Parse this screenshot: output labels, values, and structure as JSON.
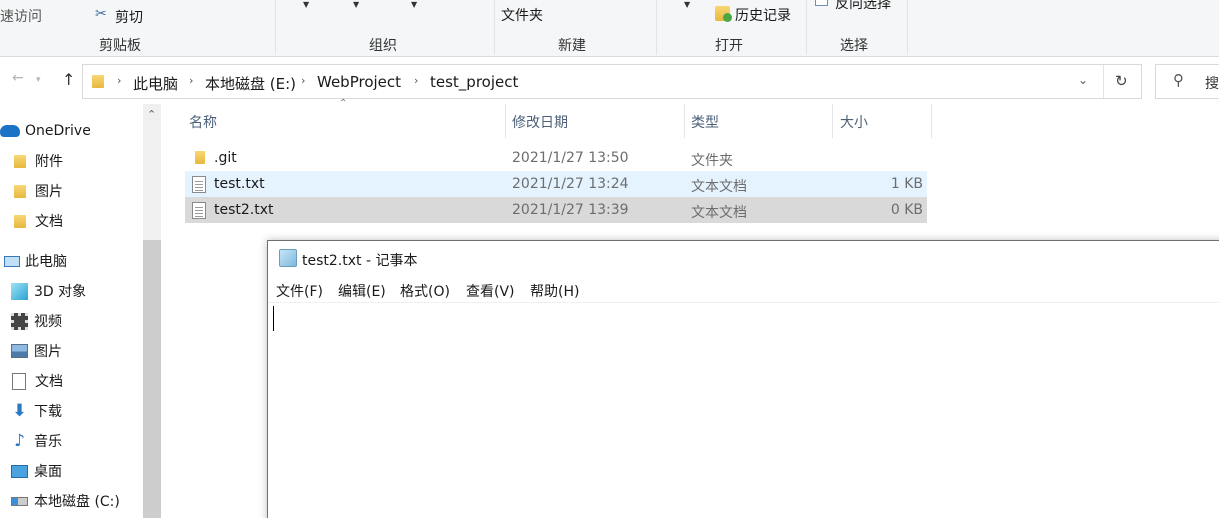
{
  "ribbon": {
    "quick_access": "速访问",
    "cut": "剪切",
    "clipboard": "剪贴板",
    "organize": "组织",
    "folder": "文件夹",
    "new": "新建",
    "open": "打开",
    "history": "历史记录",
    "select": "选择",
    "invert_select": "反向选择"
  },
  "address": {
    "crumbs": [
      "此电脑",
      "本地磁盘 (E:)",
      "WebProject",
      "test_project"
    ],
    "search_placeholder": "搜"
  },
  "sidebar": {
    "items": [
      {
        "label": "OneDrive",
        "icon": "cloud-icon"
      },
      {
        "label": "附件",
        "icon": "folder-icon"
      },
      {
        "label": "图片",
        "icon": "folder-icon"
      },
      {
        "label": "文档",
        "icon": "folder-icon"
      },
      {
        "label": "此电脑",
        "icon": "computer-icon"
      },
      {
        "label": "3D 对象",
        "icon": "cube-icon"
      },
      {
        "label": "视频",
        "icon": "film-icon"
      },
      {
        "label": "图片",
        "icon": "picture-icon"
      },
      {
        "label": "文档",
        "icon": "document-icon"
      },
      {
        "label": "下载",
        "icon": "download-arrow-icon"
      },
      {
        "label": "音乐",
        "icon": "music-note-icon"
      },
      {
        "label": "桌面",
        "icon": "desktop-icon"
      },
      {
        "label": "本地磁盘 (C:)",
        "icon": "drive-icon"
      }
    ]
  },
  "files": {
    "headers": {
      "name": "名称",
      "modified": "修改日期",
      "type": "类型",
      "size": "大小"
    },
    "rows": [
      {
        "name": ".git",
        "modified": "2021/1/27 13:50",
        "type": "文件夹",
        "size": ""
      },
      {
        "name": "test.txt",
        "modified": "2021/1/27 13:24",
        "type": "文本文档",
        "size": "1 KB"
      },
      {
        "name": "test2.txt",
        "modified": "2021/1/27 13:39",
        "type": "文本文档",
        "size": "0 KB"
      }
    ]
  },
  "notepad": {
    "title": "test2.txt - 记事本",
    "menu": [
      "文件(F)",
      "编辑(E)",
      "格式(O)",
      "查看(V)",
      "帮助(H)"
    ],
    "content": ""
  },
  "colors": {
    "hover_row": "#e5f3ff",
    "selected_row": "#d9d9d9",
    "onedrive_blue": "#0f6cbd"
  }
}
